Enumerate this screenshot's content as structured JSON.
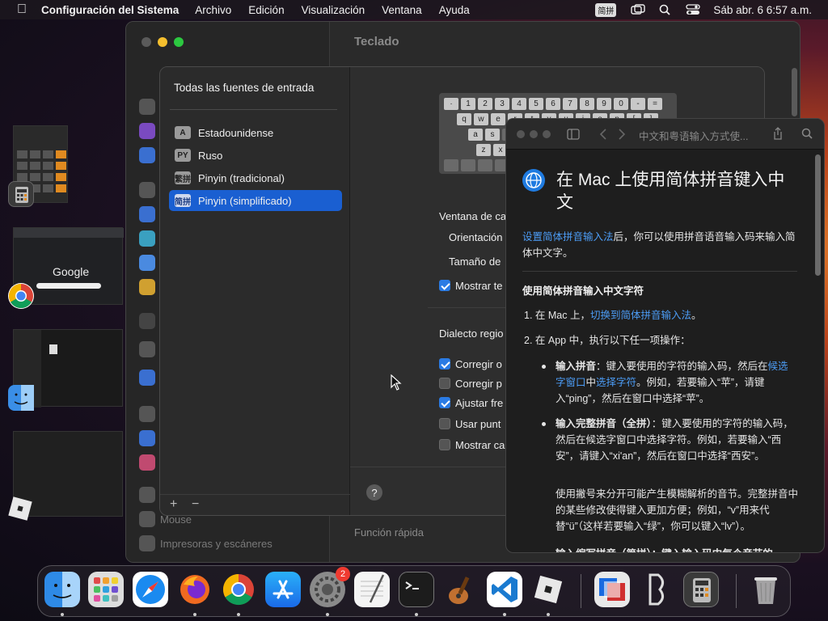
{
  "menubar": {
    "app": "Configuración del Sistema",
    "items": [
      "Archivo",
      "Edición",
      "Visualización",
      "Ventana",
      "Ayuda"
    ],
    "ime": "简拼",
    "clock": "Sáb abr. 6  6:57 a.m."
  },
  "settings": {
    "title": "Teclado",
    "sidebar_bottom": [
      "Mouse",
      "Impresoras y escáneres"
    ],
    "quick_label": "Función rápida"
  },
  "input_sources": {
    "title": "Todas las fuentes de entrada",
    "sources": [
      {
        "badge": "A",
        "label": "Estadounidense",
        "selected": false
      },
      {
        "badge": "PY",
        "label": "Ruso",
        "selected": false
      },
      {
        "badge": "繁拼",
        "label": "Pinyin (tradicional)",
        "selected": false
      },
      {
        "badge": "简拼",
        "label": "Pinyin (simplificado)",
        "selected": true
      }
    ],
    "add": "+",
    "remove": "−",
    "keyboard_keys": [
      "·",
      "1",
      "2",
      "3",
      "4",
      "5",
      "6",
      "7",
      "8",
      "9",
      "0",
      "-",
      "="
    ],
    "keyboard_row2": [
      "q",
      "w",
      "e",
      "r",
      "t",
      "y",
      "u",
      "i",
      "o",
      "p",
      "[",
      "]"
    ],
    "keyboard_row3": [
      "a",
      "s"
    ],
    "keyboard_row4": [
      "z",
      "x"
    ],
    "ventana_label": "Ventana de ca",
    "orientacion": "Orientación",
    "tamano": "Tamaño de",
    "mostrar_te": "Mostrar te",
    "dialecto": "Dialecto regio",
    "options": [
      {
        "label": "Corregir o",
        "checked": true
      },
      {
        "label": "Corregir p",
        "checked": false
      },
      {
        "label": "Ajustar fre",
        "checked": true
      },
      {
        "label": "Usar punt",
        "checked": false
      },
      {
        "label": "Mostrar ca",
        "checked": false
      }
    ],
    "help": "?"
  },
  "help_viewer": {
    "title": "中文和粤语输入方式使...",
    "heading": "在 Mac 上使用简体拼音键入中文",
    "intro_link": "设置简体拼音输入法",
    "intro_rest": "后，你可以使用拼音语音输入码来输入简体中文字。",
    "section": "使用简体拼音输入中文字符",
    "step1_pre": "1.  在 Mac 上，",
    "step1_link": "切换到简体拼音输入法",
    "step1_post": "。",
    "step2": "2.  在 App 中，执行以下任一项操作：",
    "b1_bold": "输入拼音",
    "b1_a": "：键入要使用的字符的输入码，然后在",
    "b1_link1": "候选字窗口",
    "b1_b": "中",
    "b1_link2": "选择字符",
    "b1_c": "。例如，若要输入“苹”，请键入“ping”，然后在窗口中选择“苹”。",
    "b2_bold": "输入完整拼音（全拼）",
    "b2_text": "：键入要使用的字符的输入码，然后在候选字窗口中选择字符。例如，若要输入“西安”，请键入“xi'an”，然后在窗口中选择“西安”。",
    "b2_note": "使用撇号来分开可能产生模糊解析的音节。完整拼音中的某些修改使得键入更加方便；例如，“v”用来代替“ü”（这样若要输入“绿”，你可以键入“lv”）。",
    "b3_partial": "输入缩写拼音（简拼）：键入输入码中每个音节的"
  },
  "thumbs": {
    "google": "Google"
  },
  "dock": {
    "badge_settings": "2"
  },
  "colors": {
    "accent": "#1a5fd1",
    "link": "#4c9cf5",
    "badge_red": "#f03a30"
  }
}
